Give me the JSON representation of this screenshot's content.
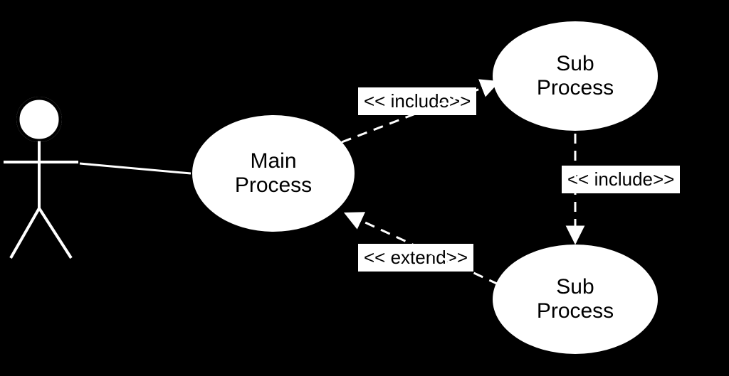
{
  "nodes": {
    "main": {
      "label": "Main\nProcess"
    },
    "sub1": {
      "label": "Sub\nProcess"
    },
    "sub2": {
      "label": "Sub\nProcess"
    }
  },
  "relations": {
    "include1": {
      "label": "<< include>>"
    },
    "include2": {
      "label": "<< include>>"
    },
    "extend1": {
      "label": "<< extend>>"
    }
  }
}
